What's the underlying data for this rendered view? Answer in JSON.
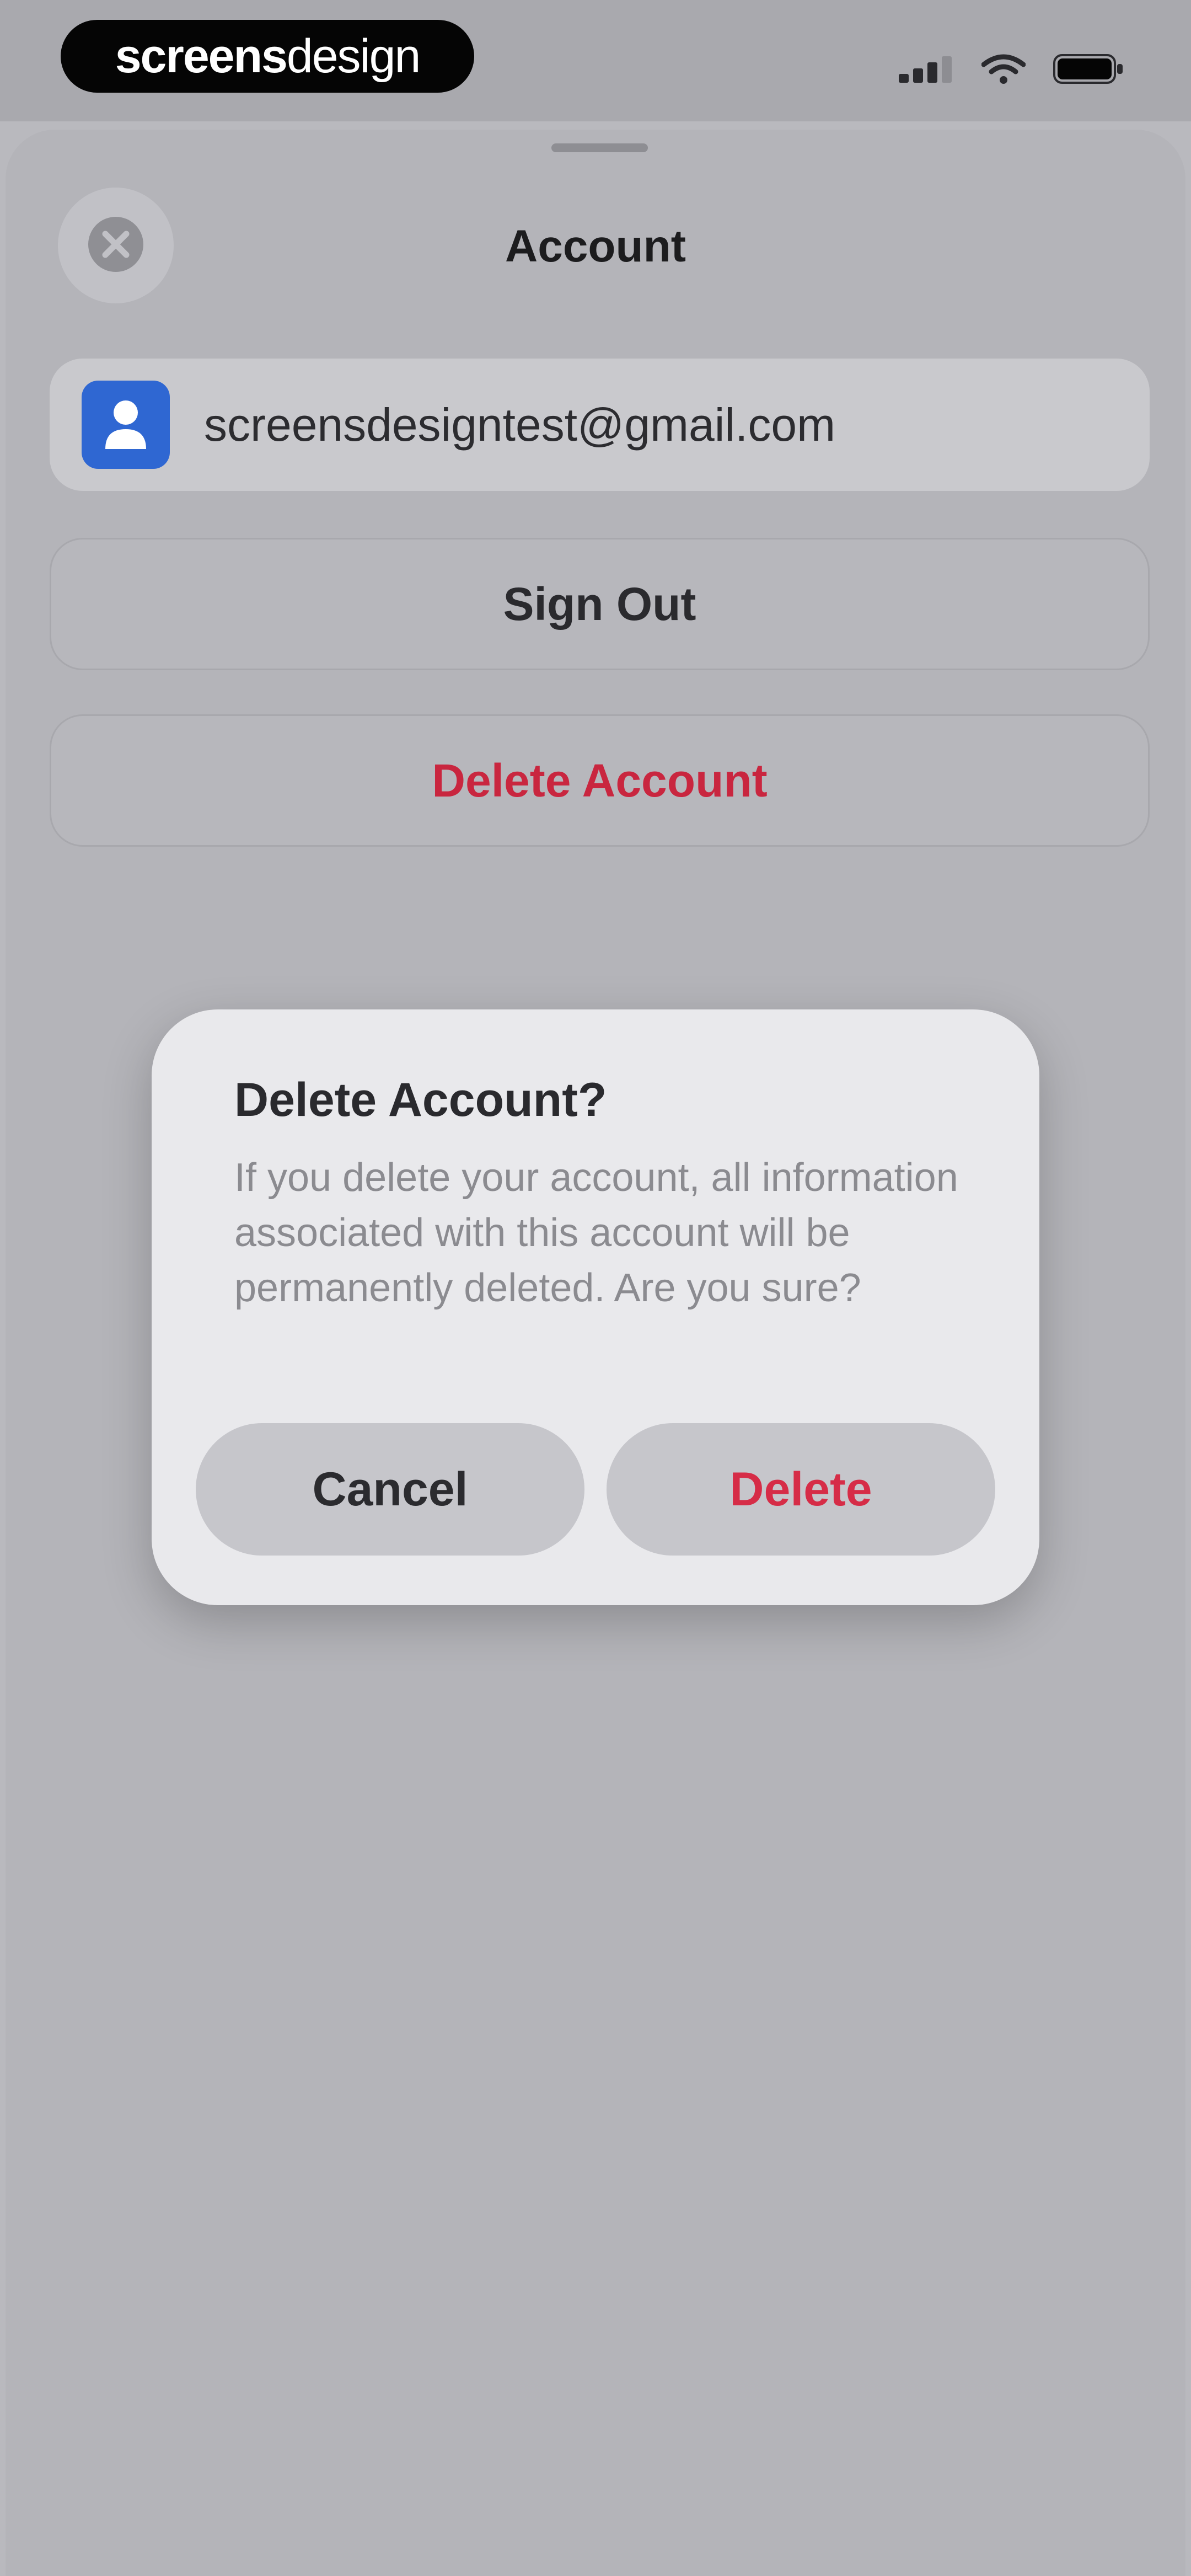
{
  "brand": {
    "part1": "screens",
    "part2": "design"
  },
  "status_icons": [
    "signal-icon",
    "wifi-icon",
    "battery-icon"
  ],
  "sheet": {
    "title": "Account",
    "close_icon": "close-icon",
    "email": "screensdesigntest@gmail.com",
    "sign_out_label": "Sign Out",
    "delete_account_label": "Delete Account"
  },
  "dialog": {
    "title": "Delete Account?",
    "message": "If you delete your account, all information associated with this account will be permanently deleted. Are you sure?",
    "cancel_label": "Cancel",
    "delete_label": "Delete"
  },
  "colors": {
    "destructive": "#d62c47",
    "avatar_blue": "#2f67d2",
    "overlay": "#b9b9be"
  }
}
